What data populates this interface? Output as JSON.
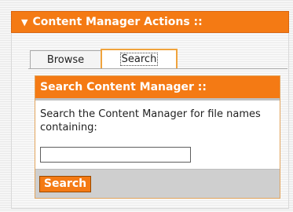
{
  "panel": {
    "title": "Content Manager Actions ::",
    "toggle_icon": "triangle-down-icon"
  },
  "tabs": [
    {
      "label": "Browse",
      "active": false
    },
    {
      "label": "Search",
      "active": true
    }
  ],
  "search_section": {
    "title": "Search Content Manager ::",
    "description": "Search the Content Manager for file names containing:",
    "input_value": "",
    "button_label": "Search"
  },
  "colors": {
    "accent": "#f47a14",
    "button_bar": "#cfcfcf"
  }
}
